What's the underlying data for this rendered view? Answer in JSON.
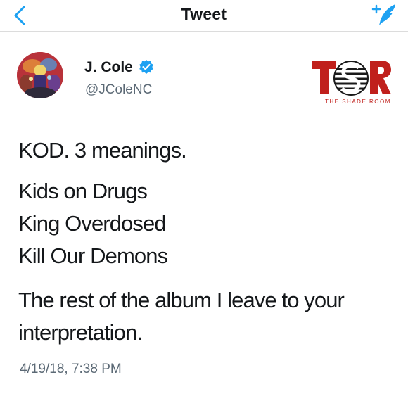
{
  "navbar": {
    "title": "Tweet",
    "back_icon": "chevron-left-icon",
    "compose_icon": "compose-feather-icon",
    "accent_color": "#1da1f2"
  },
  "tweet": {
    "author": {
      "name": "J. Cole",
      "handle": "@JColeNC",
      "verified": true,
      "verified_icon": "verified-badge-icon"
    },
    "lines": [
      "KOD. 3 meanings.",
      "Kids on Drugs",
      "King Overdosed",
      "Kill Our Demons",
      "The rest of the album I leave to your",
      "interpretation."
    ],
    "timestamp": "4/19/18, 7:38 PM"
  },
  "watermark": {
    "logo_text": "TSR",
    "caption": "THE SHADE ROOM",
    "color": "#c0201c"
  }
}
